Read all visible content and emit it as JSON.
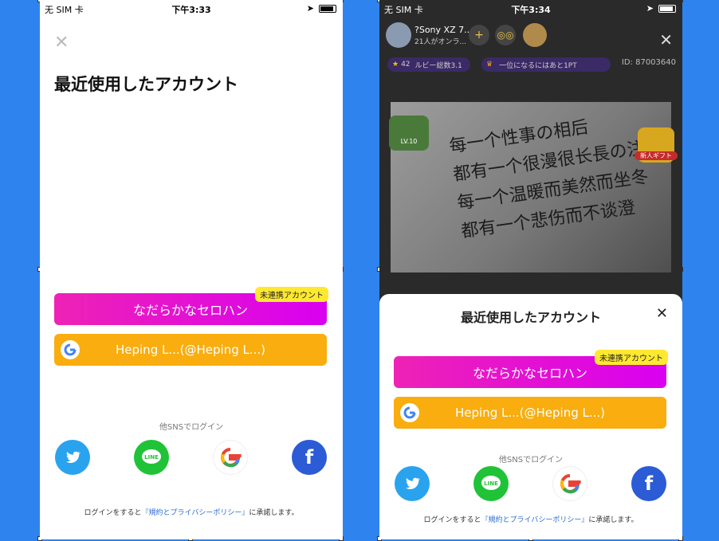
{
  "status_left": {
    "carrier": "无 SIM 卡",
    "time": "下午3:33"
  },
  "status_right": {
    "carrier": "无 SIM 卡",
    "time": "下午3:34"
  },
  "login": {
    "title": "最近使用したアカウント",
    "recent_account_name": "なだらかなセロハン",
    "unlinked_badge": "未連携アカウント",
    "google_account": "Heping L...(@Heping L...)",
    "other_sns_label": "他SNSでログイン",
    "sns": [
      "twitter-icon",
      "line-icon",
      "google-icon",
      "facebook-icon"
    ],
    "line_text": "LINE",
    "facebook_text": "f",
    "terms_prefix": "ログインをすると",
    "terms_link": "『規約とプライバシーポリシー』",
    "terms_suffix": "に承諾します。"
  },
  "live": {
    "room_name": "?Sony XZ 7...",
    "room_sub": "21人がオンラ...",
    "ruby_pill": "ルビー総数3.1",
    "ruby_count": "42",
    "rank_pill": "一位になるにはあと1PT",
    "room_id": "ID: 87003640",
    "lv_badge": "LV.10",
    "gift_label": "新人ギフト",
    "handwriting": [
      "每一个性事の相后",
      "都有一个很漫很长長の注法",
      "每一个温暖而美然而坐冬",
      "都有一个悲伤而不谈澄"
    ]
  },
  "colors": {
    "gradient_start": "#ee22b5",
    "gradient_end": "#d900f0",
    "google_btn": "#f9ad0e",
    "badge": "#ffe830",
    "background": "#2f83ee"
  }
}
